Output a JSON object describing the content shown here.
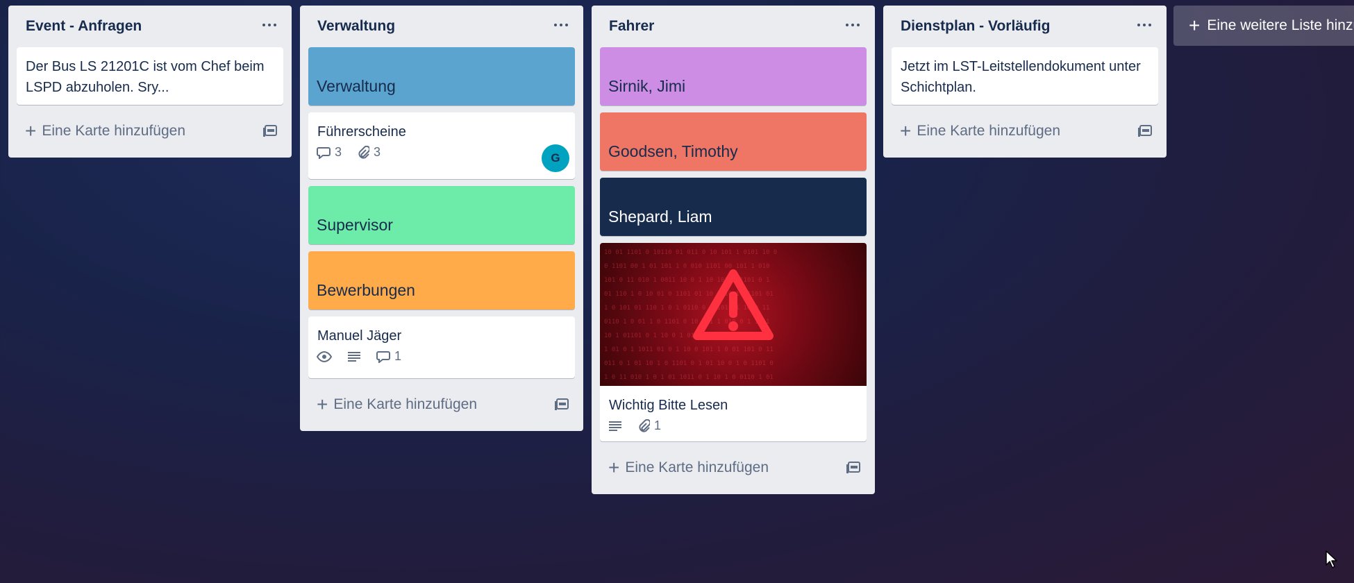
{
  "lists": [
    {
      "title": "Event - Anfragen",
      "cards": [
        {
          "text": "Der Bus LS 21201C ist vom Chef beim LSPD abzuholen. Sry..."
        }
      ],
      "add_card_label": "Eine Karte hinzufügen"
    },
    {
      "title": "Verwaltung",
      "cards": [
        {
          "title": "Verwaltung",
          "cover_color": "#5ba4cf"
        },
        {
          "title": "Führerscheine",
          "comments": "3",
          "attachments": "3",
          "avatar": "G"
        },
        {
          "title": "Supervisor",
          "cover_color": "#6deca9"
        },
        {
          "title": "Bewerbungen",
          "cover_color": "#ffab4a"
        },
        {
          "title": "Manuel Jäger",
          "comments": "1"
        }
      ],
      "add_card_label": "Eine Karte hinzufügen"
    },
    {
      "title": "Fahrer",
      "cards": [
        {
          "title": "Sirnik, Jimi",
          "cover_color": "#cd8de5"
        },
        {
          "title": "Goodsen, Timothy",
          "cover_color": "#ef7564"
        },
        {
          "title": "Shepard, Liam",
          "cover_color": "#172b4d"
        },
        {
          "title": "Wichtig Bitte Lesen",
          "attachments": "1",
          "cover_image": "warning-icon"
        }
      ],
      "add_card_label": "Eine Karte hinzufügen"
    },
    {
      "title": "Dienstplan - Vorläufig",
      "cards": [
        {
          "text": "Jetzt im LST-Leitstellendokument unter Schichtplan."
        }
      ],
      "add_card_label": "Eine Karte hinzufügen"
    }
  ],
  "add_list_label": "Eine weitere Liste hinzu",
  "colors": {
    "list_bg": "#ebecf0",
    "text": "#172b4d",
    "muted": "#5e6c84",
    "avatar": "#00a3bf"
  }
}
